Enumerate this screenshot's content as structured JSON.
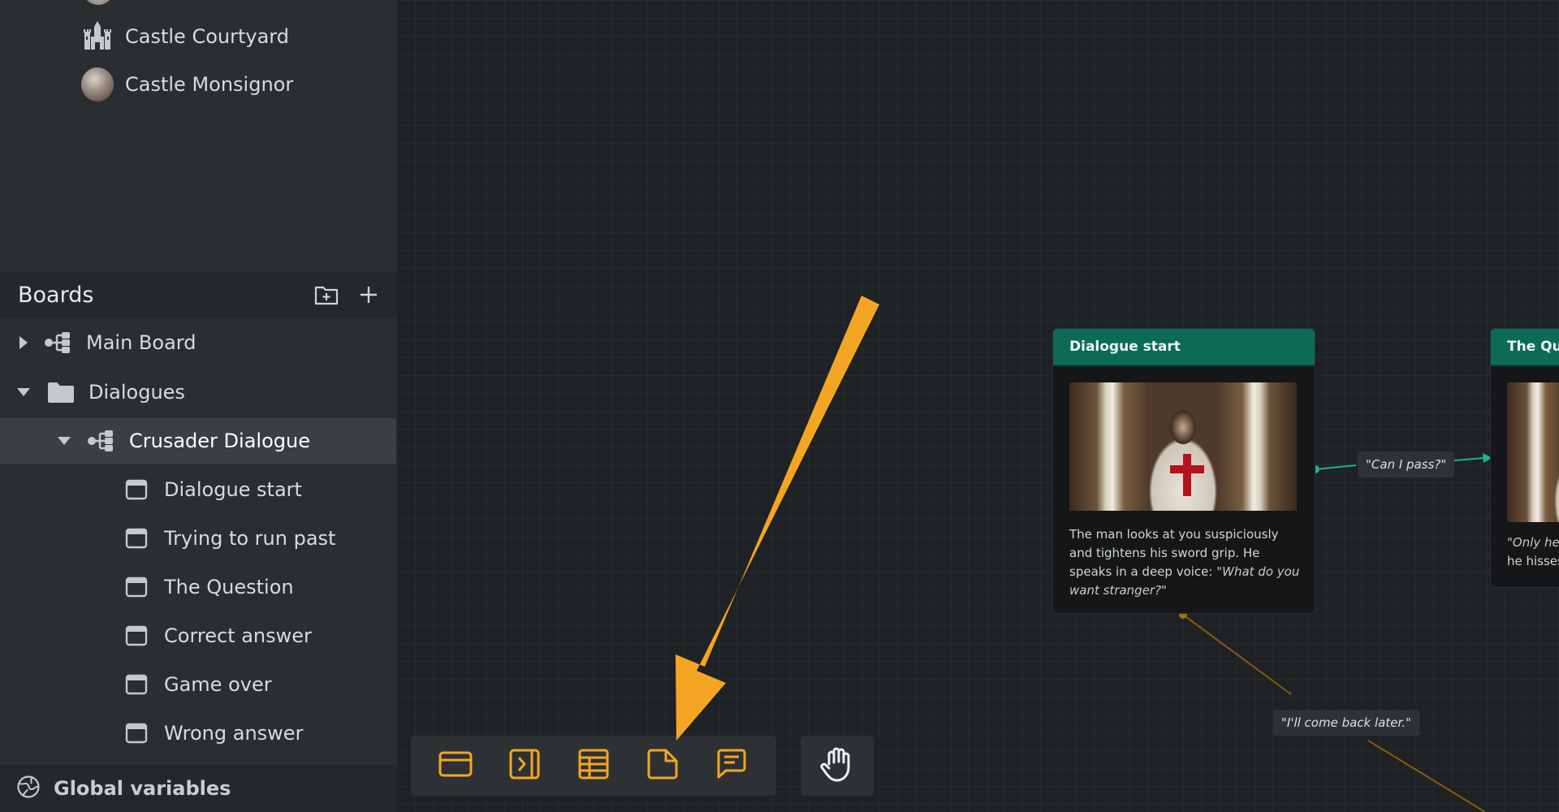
{
  "sidebar": {
    "top_items": [
      {
        "label": "Castle Courtyard",
        "icon": "castle-icon"
      },
      {
        "label": "Castle Monsignor",
        "icon": "avatar"
      }
    ],
    "boards_header": {
      "title": "Boards",
      "add_folder_icon": "folder-plus-icon",
      "add_icon": "plus-icon"
    },
    "tree": [
      {
        "label": "Main Board",
        "icon": "board-icon",
        "expanded": false
      },
      {
        "label": "Dialogues",
        "icon": "folder-icon",
        "expanded": true
      },
      {
        "label": "Crusader Dialogue",
        "icon": "board-icon",
        "expanded": true,
        "selected": true
      },
      {
        "label": "Dialogue start",
        "icon": "card-icon"
      },
      {
        "label": "Trying to run past",
        "icon": "card-icon"
      },
      {
        "label": "The Question",
        "icon": "card-icon"
      },
      {
        "label": "Correct answer",
        "icon": "card-icon"
      },
      {
        "label": "Game over",
        "icon": "card-icon"
      },
      {
        "label": "Wrong answer",
        "icon": "card-icon"
      }
    ],
    "global_variables": {
      "label": "Global variables",
      "icon": "globe-icon"
    }
  },
  "canvas": {
    "node_main": {
      "title": "Dialogue start",
      "text": "The man looks at you suspiciously and tightens his sword grip. He speaks in a deep voice: ",
      "quote": "\"What do you want stranger?\""
    },
    "node_right": {
      "title": "The Que",
      "text_line1": "\"Only he w",
      "text_line2": "he hisses"
    },
    "edge_labels": {
      "can_i_pass": "\"Can I pass?\"",
      "come_back": "\"I'll come back later.\""
    }
  },
  "toolbar": {
    "tools": [
      {
        "name": "card-tool",
        "icon": "card-icon"
      },
      {
        "name": "jump-tool",
        "icon": "jump-icon"
      },
      {
        "name": "table-tool",
        "icon": "table-icon"
      },
      {
        "name": "note-tool",
        "icon": "note-icon"
      },
      {
        "name": "comment-tool",
        "icon": "comment-icon"
      }
    ],
    "hand_tool_icon": "hand-icon"
  },
  "colors": {
    "accent_orange": "#f5a524",
    "node_header_teal": "#0b6b57",
    "edge_teal": "#19b393",
    "edge_brown": "#8a5a0e"
  }
}
